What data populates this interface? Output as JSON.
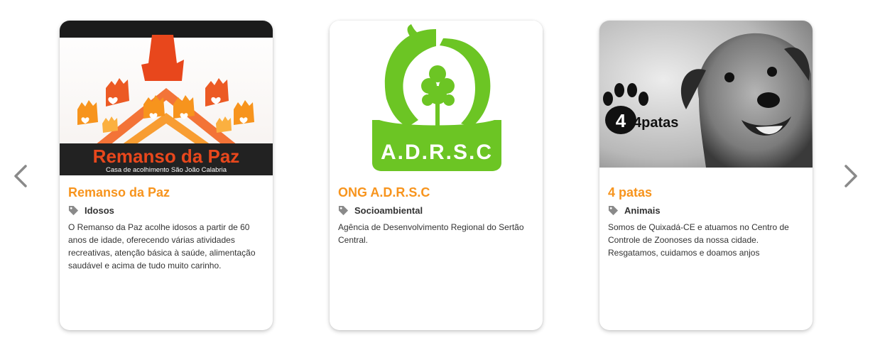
{
  "carousel": {
    "prev_icon": "chevron-left-icon",
    "next_icon": "chevron-right-icon",
    "accent_color": "#f7941d",
    "cards": [
      {
        "image": {
          "logo_title": "Remanso da Paz",
          "logo_subtitle": "Casa de acolhimento São João Calabria"
        },
        "title": "Remanso da Paz",
        "tag_icon": "tag-icon",
        "tag": "Idosos",
        "description": "O Remanso da Paz acolhe idosos a partir de 60 anos de idade, oferecendo várias atividades recreativas, atenção básica à saúde, alimentação saudável e acima de tudo muito carinho."
      },
      {
        "image": {
          "logo_text": "A.D.R.S.C",
          "logo_color": "#6cc524"
        },
        "title": "ONG A.D.R.S.C",
        "tag_icon": "tag-icon",
        "tag": "Socioambiental",
        "description": "Agência de Desenvolvimento Regional do Sertão Central."
      },
      {
        "image": {
          "logo_text": "4patas"
        },
        "title": "4 patas",
        "tag_icon": "tag-icon",
        "tag": "Animais",
        "description": "Somos de Quixadá-CE e atuamos no Centro de Controle de Zoonoses da nossa cidade. Resgatamos, cuidamos e doamos anjos"
      }
    ]
  }
}
